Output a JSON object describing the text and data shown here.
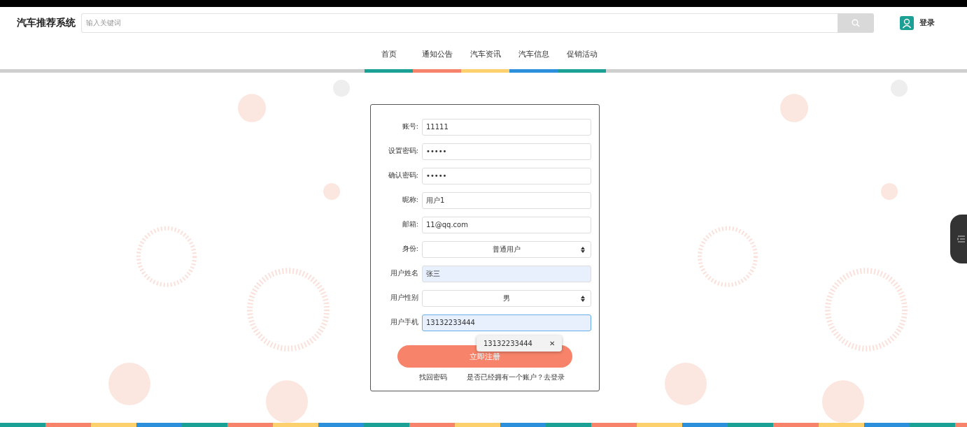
{
  "header": {
    "logo": "汽车推荐系统",
    "search": {
      "placeholder": "输入关键词"
    },
    "login": "登录"
  },
  "nav": [
    {
      "label": "首页",
      "color": "#1aa094"
    },
    {
      "label": "通知公告",
      "color": "#f7836a"
    },
    {
      "label": "汽车资讯",
      "color": "#fdd06e"
    },
    {
      "label": "汽车信息",
      "color": "#2b8fdc"
    },
    {
      "label": "促销活动",
      "color": "#1aa094"
    }
  ],
  "form": {
    "fields": [
      {
        "kind": "input",
        "label": "账号:",
        "value": "11111",
        "autofilled": false,
        "focused": false
      },
      {
        "kind": "input",
        "label": "设置密码:",
        "value": "•••••",
        "autofilled": false,
        "focused": false
      },
      {
        "kind": "input",
        "label": "确认密码:",
        "value": "•••••",
        "autofilled": false,
        "focused": false
      },
      {
        "kind": "input",
        "label": "昵称:",
        "value": "用户1",
        "autofilled": false,
        "focused": false
      },
      {
        "kind": "input",
        "label": "邮箱:",
        "value": "11@qq.com",
        "autofilled": false,
        "focused": false
      },
      {
        "kind": "select",
        "label": "身份:",
        "value": "普通用户",
        "autofilled": false,
        "focused": false
      },
      {
        "kind": "input",
        "label": "用户姓名",
        "value": "张三",
        "autofilled": true,
        "focused": false
      },
      {
        "kind": "select",
        "label": "用户性别",
        "value": "男",
        "autofilled": false,
        "focused": false
      },
      {
        "kind": "input",
        "label": "用户手机",
        "value": "13132233444",
        "autofilled": true,
        "focused": true
      }
    ],
    "autocomplete": {
      "value": "13132233444",
      "close": "✕"
    },
    "submit": "立即注册",
    "links": [
      "找回密码",
      "是否已经拥有一个账户？去登录"
    ]
  }
}
